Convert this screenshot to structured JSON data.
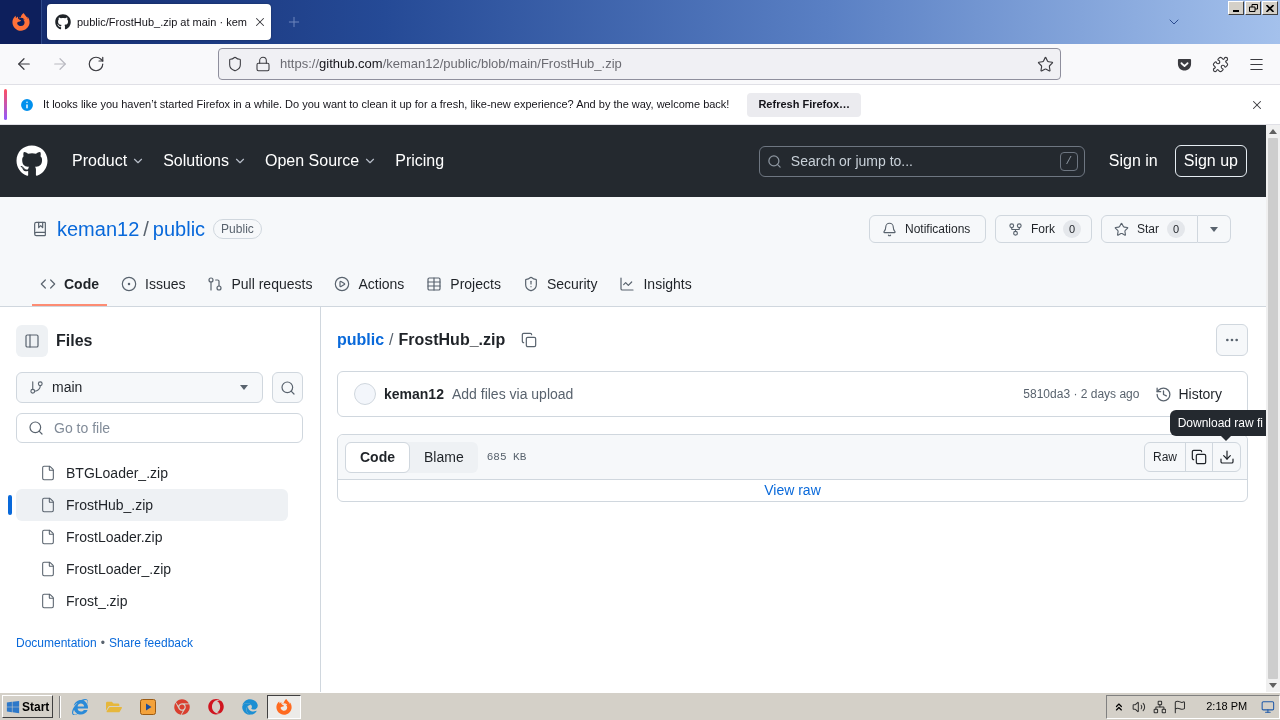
{
  "browser": {
    "tab": {
      "title": "public/FrostHub_.zip at main · kem",
      "selected": true
    },
    "nav": [
      {
        "kind": "back",
        "disabled": false
      },
      {
        "kind": "forward",
        "disabled": true
      },
      {
        "kind": "reload",
        "disabled": false
      }
    ],
    "address": {
      "scheme": "https://",
      "host": "github.com",
      "path": "/keman12/public/blob/main/FrostHub_.zip"
    },
    "notification": {
      "message": "It looks like you haven’t started Firefox in a while. Do you want to clean it up for a fresh, like-new experience? And by the way, welcome back!",
      "button": "Refresh Firefox…"
    }
  },
  "header": {
    "nav": [
      {
        "label": "Product",
        "has_menu": true
      },
      {
        "label": "Solutions",
        "has_menu": true
      },
      {
        "label": "Open Source",
        "has_menu": true
      },
      {
        "label": "Pricing",
        "has_menu": false
      }
    ],
    "search": {
      "placeholder": "Search or jump to...",
      "shortcut": "/"
    },
    "sign_in": "Sign in",
    "sign_up": "Sign up"
  },
  "repo": {
    "owner": "keman12",
    "separator": "/",
    "name": "public",
    "visibility": "Public",
    "actions": [
      {
        "kind": "notifications",
        "label": "Notifications",
        "has_menu": false
      },
      {
        "kind": "fork",
        "label": "Fork",
        "count": "0",
        "has_menu": false
      },
      {
        "kind": "star",
        "label": "Star",
        "count": "0",
        "has_menu": true
      }
    ],
    "tabs": [
      {
        "kind": "code",
        "label": "Code",
        "selected": true
      },
      {
        "kind": "issues",
        "label": "Issues",
        "selected": false
      },
      {
        "kind": "pulls",
        "label": "Pull requests",
        "selected": false
      },
      {
        "kind": "actions",
        "label": "Actions",
        "selected": false
      },
      {
        "kind": "projects",
        "label": "Projects",
        "selected": false
      },
      {
        "kind": "security",
        "label": "Security",
        "selected": false
      },
      {
        "kind": "insights",
        "label": "Insights",
        "selected": false
      }
    ]
  },
  "sidebar": {
    "title": "Files",
    "branch": "main",
    "filter": {
      "placeholder": "Go to file"
    },
    "files": [
      {
        "name": "BTGLoader_.zip",
        "selected": false
      },
      {
        "name": "FrostHub_.zip",
        "selected": true
      },
      {
        "name": "FrostLoader.zip",
        "selected": false
      },
      {
        "name": "FrostLoader_.zip",
        "selected": false
      },
      {
        "name": "Frost_.zip",
        "selected": false
      }
    ],
    "footer": {
      "links": [
        "Documentation",
        "Share feedback"
      ],
      "separator": "•"
    }
  },
  "file": {
    "breadcrumb": {
      "repo": "public",
      "separator": "/",
      "name": "FrostHub_.zip"
    },
    "commit": {
      "author": "keman12",
      "message": "Add files via upload",
      "info": "5810da3 · 2 days ago",
      "history": "History"
    },
    "view_modes": [
      {
        "label": "Code",
        "selected": true
      },
      {
        "label": "Blame",
        "selected": false
      }
    ],
    "size": "685 KB",
    "raw": "Raw",
    "view_raw": "View raw",
    "tooltip": "Download raw fi"
  },
  "taskbar": {
    "start": "Start",
    "apps": [
      {
        "kind": "ie",
        "selected": false
      },
      {
        "kind": "explorer",
        "selected": false
      },
      {
        "kind": "media",
        "selected": false
      },
      {
        "kind": "chrome",
        "selected": false
      },
      {
        "kind": "opera",
        "selected": false
      },
      {
        "kind": "edge",
        "selected": false
      },
      {
        "kind": "firefox",
        "selected": true
      }
    ],
    "clock": "2:18 PM"
  }
}
